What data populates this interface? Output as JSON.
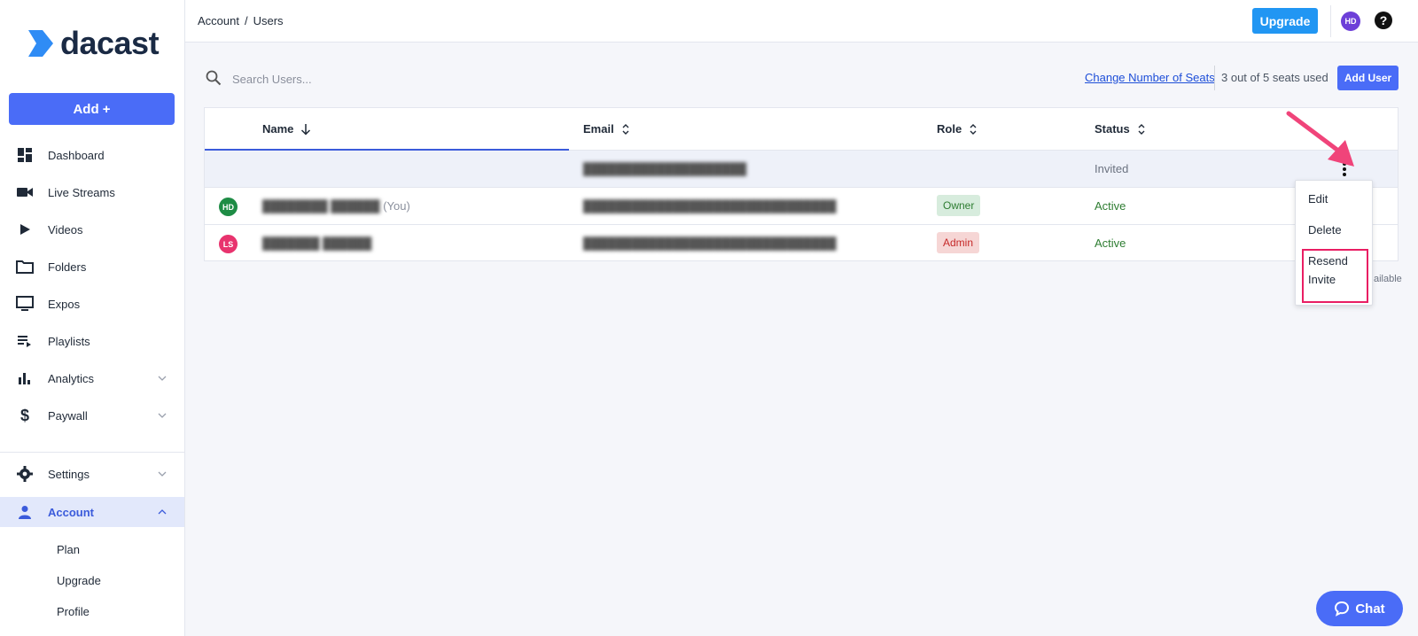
{
  "app": {
    "name": "dacast"
  },
  "sidebar": {
    "add_label": "Add +",
    "items": [
      {
        "label": "Dashboard",
        "icon": "dashboard-icon"
      },
      {
        "label": "Live Streams",
        "icon": "video-camera-icon"
      },
      {
        "label": "Videos",
        "icon": "play-icon"
      },
      {
        "label": "Folders",
        "icon": "folder-icon"
      },
      {
        "label": "Expos",
        "icon": "monitor-icon"
      },
      {
        "label": "Playlists",
        "icon": "playlist-icon"
      },
      {
        "label": "Analytics",
        "icon": "bar-chart-icon"
      },
      {
        "label": "Paywall",
        "icon": "dollar-icon"
      },
      {
        "label": "Settings",
        "icon": "gear-icon"
      },
      {
        "label": "Account",
        "icon": "user-icon"
      }
    ],
    "account_sub": [
      "Plan",
      "Upgrade",
      "Profile"
    ]
  },
  "header": {
    "breadcrumb": [
      "Account",
      "Users"
    ],
    "breadcrumb_sep": "/",
    "upgrade_label": "Upgrade",
    "avatar_initials": "HD",
    "help_glyph": "?"
  },
  "toolbar": {
    "search_placeholder": "Search Users...",
    "change_seats_label": "Change Number of Seats",
    "seats_used": "3 out of 5 seats used",
    "add_user_label": "Add User"
  },
  "table": {
    "columns": [
      "Name",
      "Email",
      "Role",
      "Status"
    ],
    "rows": [
      {
        "initials": "",
        "name": "",
        "you": "",
        "email": "████████████████████",
        "role": "",
        "status": "Invited"
      },
      {
        "initials": "HD",
        "name": "████████ ██████",
        "you": "(You)",
        "email": "███████████████████████████████",
        "role": "Owner",
        "status": "Active"
      },
      {
        "initials": "LS",
        "name": "███████ ██████",
        "you": "",
        "email": "███████████████████████████████",
        "role": "Admin",
        "status": "Active"
      }
    ],
    "footer_text": "ailable"
  },
  "dropdown": {
    "edit": "Edit",
    "delete": "Delete",
    "resend_line1": "Resend",
    "resend_line2": "Invite"
  },
  "chat": {
    "label": "Chat"
  },
  "colors": {
    "accent": "#4a6cf7",
    "upgrade": "#2196f3",
    "avatar_hd": "#1e8c45",
    "avatar_ls": "#e8336e",
    "highlight": "#e91e63"
  }
}
